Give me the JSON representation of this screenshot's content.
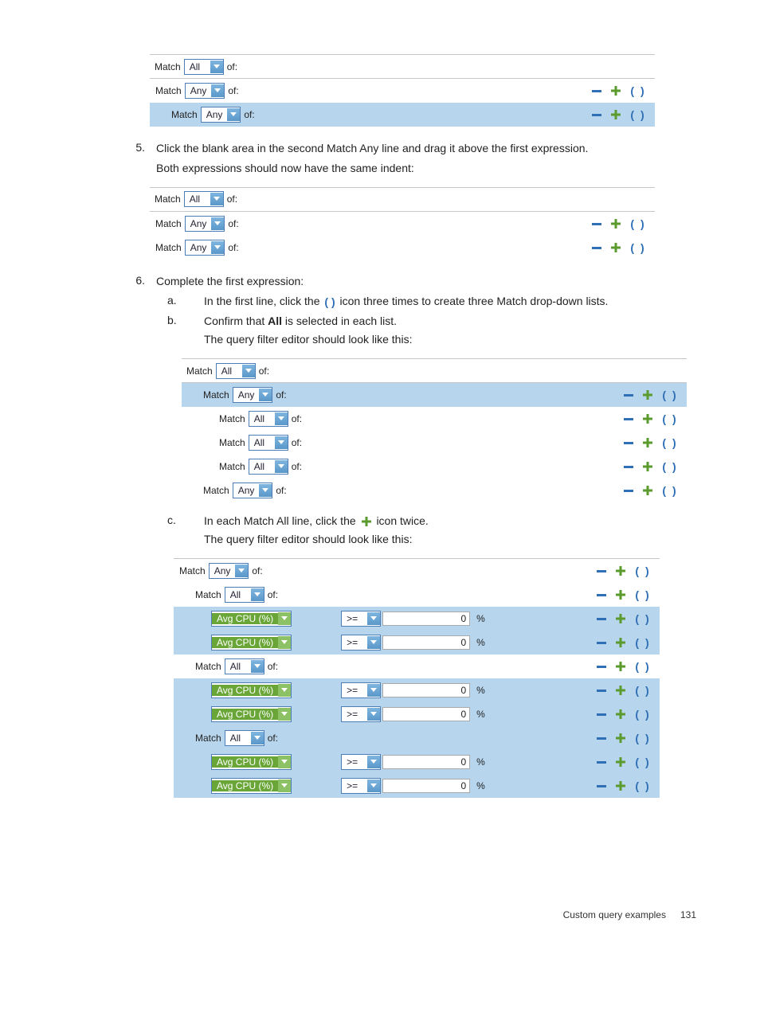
{
  "common": {
    "match": "Match",
    "of": "of:",
    "opt_all": "All",
    "opt_any": "Any",
    "metric": "Avg CPU (%)",
    "op": ">=",
    "val0": "0",
    "unit": "%",
    "minus": "−",
    "plus": "+",
    "paren": "( )"
  },
  "step5": {
    "num": "5.",
    "text1": "Click the blank area in the second Match Any line and drag it above the first expression.",
    "text2": "Both expressions should now have the same indent:"
  },
  "step6": {
    "num": "6.",
    "text1": "Complete the first expression:",
    "a_mark": "a.",
    "a_text_pre": "In the first line, click the ",
    "a_text_post": " icon three times to create three Match drop-down lists.",
    "b_mark": "b.",
    "b_text1_pre": "Confirm that ",
    "b_text1_bold": "All",
    "b_text1_post": " is selected in each list.",
    "b_text2": "The query filter editor should look like this:",
    "c_mark": "c.",
    "c_text1_pre": "In each Match All line, click the ",
    "c_text1_post": " icon twice.",
    "c_text2": "The query filter editor should look like this:"
  },
  "footer": {
    "title": "Custom query examples",
    "page": "131"
  }
}
